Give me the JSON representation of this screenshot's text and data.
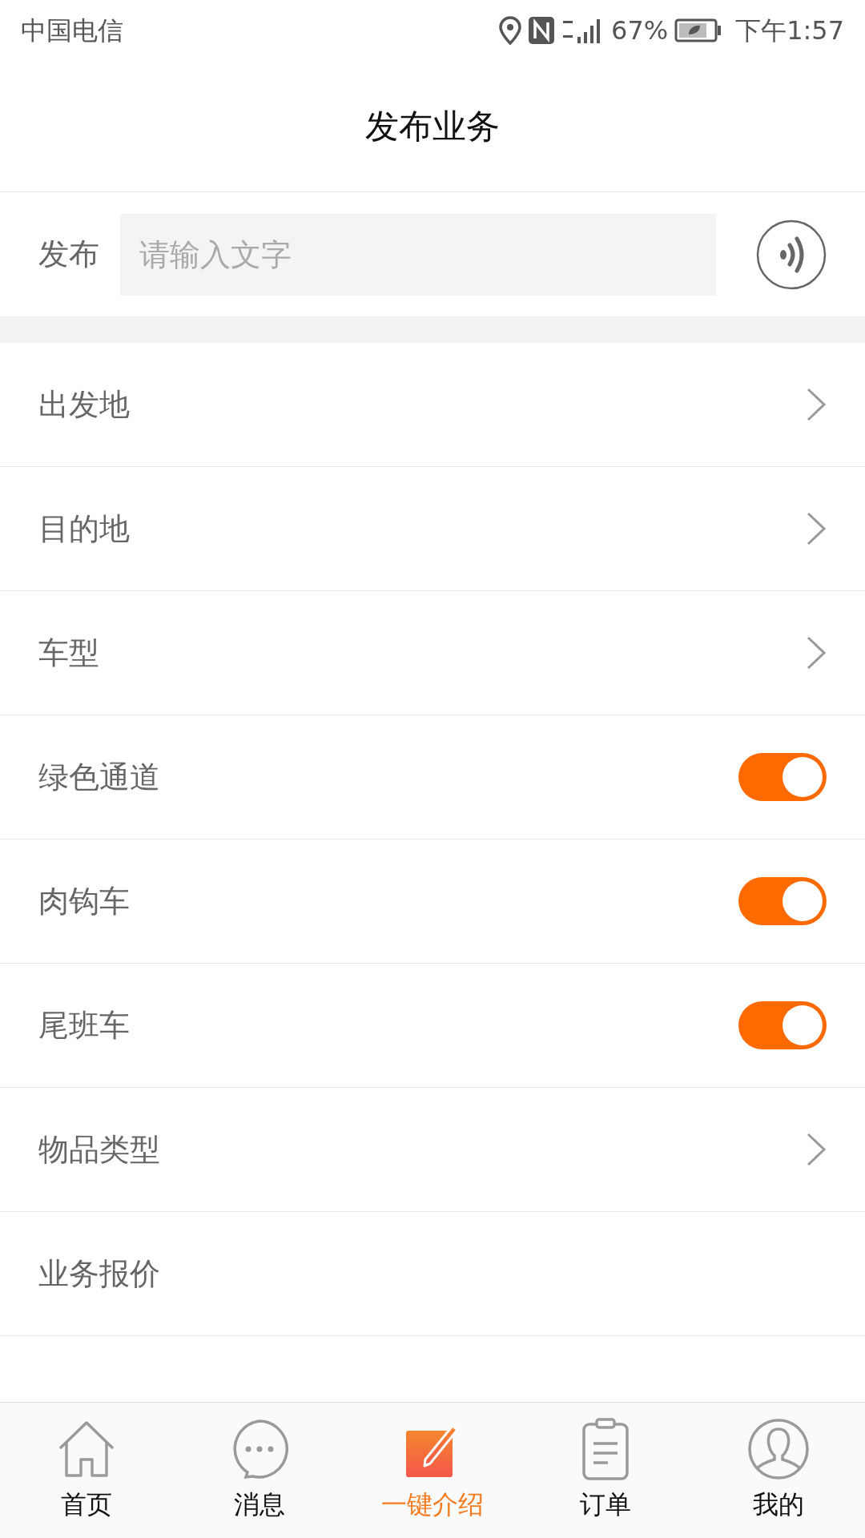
{
  "status_bar": {
    "carrier": "中国电信",
    "battery_percent": "67%",
    "time": "下午1:57"
  },
  "header": {
    "title": "发布业务"
  },
  "publish": {
    "label": "发布",
    "placeholder": "请输入文字"
  },
  "rows": [
    {
      "label": "出发地",
      "kind": "link"
    },
    {
      "label": "目的地",
      "kind": "link"
    },
    {
      "label": "车型",
      "kind": "link"
    },
    {
      "label": "绿色通道",
      "kind": "toggle",
      "on": true
    },
    {
      "label": "肉钩车",
      "kind": "toggle",
      "on": true
    },
    {
      "label": "尾班车",
      "kind": "toggle",
      "on": true
    },
    {
      "label": "物品类型",
      "kind": "link"
    },
    {
      "label": "业务报价",
      "kind": "plain"
    }
  ],
  "tab_bar": [
    {
      "label": "首页",
      "selected": false
    },
    {
      "label": "消息",
      "selected": false
    },
    {
      "label": "一键介绍",
      "selected": true
    },
    {
      "label": "订单",
      "selected": false
    },
    {
      "label": "我的",
      "selected": false
    }
  ]
}
